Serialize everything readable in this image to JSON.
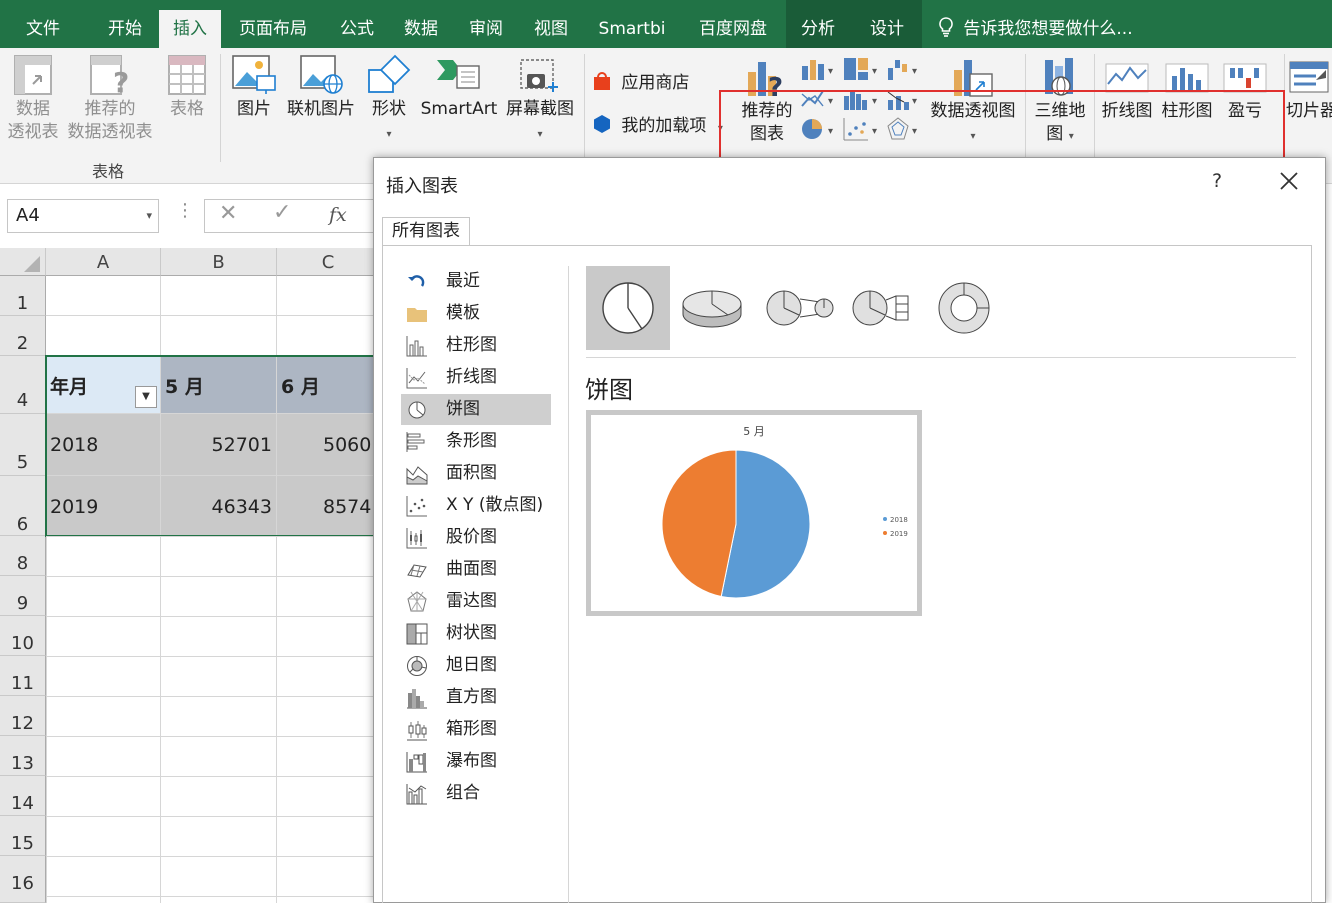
{
  "tabs": [
    {
      "label": "文件",
      "active": false
    },
    {
      "label": "开始",
      "active": false
    },
    {
      "label": "插入",
      "active": true
    },
    {
      "label": "页面布局",
      "active": false
    },
    {
      "label": "公式",
      "active": false
    },
    {
      "label": "数据",
      "active": false
    },
    {
      "label": "审阅",
      "active": false
    },
    {
      "label": "视图",
      "active": false
    },
    {
      "label": "Smartbi",
      "active": false
    },
    {
      "label": "百度网盘",
      "active": false
    },
    {
      "label": "分析",
      "active": false
    },
    {
      "label": "设计",
      "active": false
    }
  ],
  "tell_me": "告诉我您想要做什么...",
  "ribbon": {
    "table_group": {
      "pivot_line1": "数据",
      "pivot_line2": "透视表",
      "rec_pivot_line1": "推荐的",
      "rec_pivot_line2": "数据透视表",
      "table": "表格",
      "group_label": "表格"
    },
    "illustrations": {
      "picture": "图片",
      "online_picture": "联机图片",
      "shapes": "形状",
      "smartart": "SmartArt",
      "screenshot": "屏幕截图"
    },
    "addins": {
      "store": "应用商店",
      "my_addins": "我的加载项"
    },
    "charts": {
      "recommended_line1": "推荐的",
      "recommended_line2": "图表",
      "pivot_chart": "数据透视图"
    },
    "tours": {
      "map_line1": "三维地",
      "map_line2": "图"
    },
    "sparklines": {
      "line": "折线图",
      "column": "柱形图",
      "winloss": "盈亏"
    },
    "filters": {
      "slicer": "切片器"
    }
  },
  "namebox": "A4",
  "fx": "fx",
  "sheet": {
    "columns": [
      "A",
      "B",
      "C"
    ],
    "rows": [
      "1",
      "2",
      "4",
      "5",
      "6",
      "8",
      "9",
      "10",
      "11",
      "12",
      "13",
      "14",
      "15",
      "16"
    ],
    "header": [
      "年月",
      "5 月",
      "6 月"
    ],
    "data": [
      [
        "2018",
        "52701",
        "5060"
      ],
      [
        "2019",
        "46343",
        "8574"
      ]
    ]
  },
  "dialog": {
    "title": "插入图表",
    "help": "?",
    "tab": "所有图表",
    "categories": [
      "最近",
      "模板",
      "柱形图",
      "折线图",
      "饼图",
      "条形图",
      "面积图",
      "X Y (散点图)",
      "股价图",
      "曲面图",
      "雷达图",
      "树状图",
      "旭日图",
      "直方图",
      "箱形图",
      "瀑布图",
      "组合"
    ],
    "selected_category": "饼图",
    "chart_type_title": "饼图"
  },
  "colors": {
    "excel_green": "#217346",
    "series_2018": "#5b9bd5",
    "series_2019": "#ed7d31",
    "highlight": "#e0302e"
  },
  "chart_data": {
    "type": "pie",
    "title": "5 月",
    "categories": [
      "2018",
      "2019"
    ],
    "values": [
      52701,
      46343
    ],
    "legend": "right"
  }
}
